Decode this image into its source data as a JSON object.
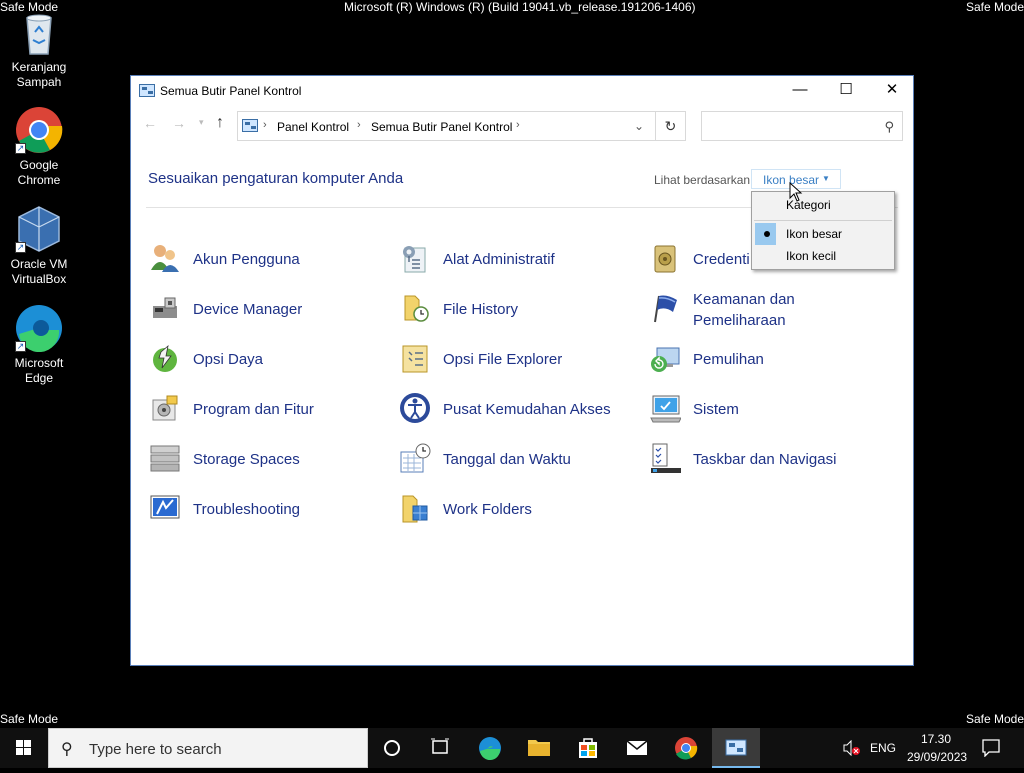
{
  "safe_mode_label": "Safe Mode",
  "os_build": "Microsoft (R) Windows (R) (Build 19041.vb_release.191206-1406)",
  "desktop_icons": [
    {
      "label_line1": "Keranjang",
      "label_line2": "Sampah",
      "icon": "recycle-bin-icon"
    },
    {
      "label_line1": "Google",
      "label_line2": "Chrome",
      "icon": "chrome-icon"
    },
    {
      "label_line1": "Oracle VM",
      "label_line2": "VirtualBox",
      "icon": "virtualbox-icon"
    },
    {
      "label_line1": "Microsoft",
      "label_line2": "Edge",
      "icon": "edge-icon"
    }
  ],
  "window": {
    "title": "Semua Butir Panel Kontrol",
    "breadcrumb": [
      "Panel Kontrol",
      "Semua Butir Panel Kontrol"
    ],
    "search_placeholder": "",
    "heading": "Sesuaikan pengaturan komputer Anda",
    "view_by_label": "Lihat berdasarkan:",
    "view_by_value": "Ikon besar"
  },
  "view_menu": {
    "options": [
      "Kategori",
      "Ikon besar",
      "Ikon kecil"
    ],
    "selected": "Ikon besar"
  },
  "items": [
    {
      "label": "Akun Pengguna",
      "icon": "user-accounts-icon"
    },
    {
      "label": "Alat Administratif",
      "icon": "admin-tools-icon"
    },
    {
      "label": "Credenti",
      "icon": "credential-manager-icon"
    },
    {
      "label": "Device Manager",
      "icon": "device-manager-icon"
    },
    {
      "label": "File History",
      "icon": "file-history-icon"
    },
    {
      "label": "Keamanan dan",
      "label2": "Pemeliharaan",
      "icon": "security-maintenance-flag-icon"
    },
    {
      "label": "Opsi Daya",
      "icon": "power-options-icon"
    },
    {
      "label": "Opsi File Explorer",
      "icon": "file-explorer-options-icon"
    },
    {
      "label": "Pemulihan",
      "icon": "recovery-icon"
    },
    {
      "label": "Program dan Fitur",
      "icon": "programs-features-icon"
    },
    {
      "label": "Pusat Kemudahan Akses",
      "icon": "ease-of-access-icon"
    },
    {
      "label": "Sistem",
      "icon": "system-icon"
    },
    {
      "label": "Storage Spaces",
      "icon": "storage-spaces-icon"
    },
    {
      "label": "Tanggal dan Waktu",
      "icon": "date-time-icon"
    },
    {
      "label": "Taskbar dan Navigasi",
      "icon": "taskbar-navigation-icon"
    },
    {
      "label": "Troubleshooting",
      "icon": "troubleshooting-icon"
    },
    {
      "label": "Work Folders",
      "icon": "work-folders-icon"
    }
  ],
  "taskbar": {
    "search_placeholder": "Type here to search",
    "language": "ENG",
    "time": "17.30",
    "date": "29/09/2023"
  }
}
